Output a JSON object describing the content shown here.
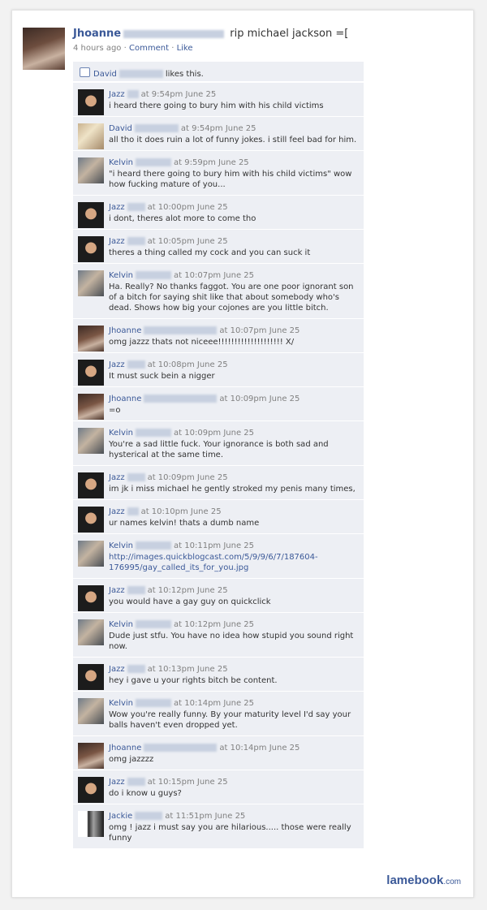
{
  "post": {
    "author": "Jhoanne",
    "status": "rip michael jackson =[",
    "time": "4 hours ago",
    "comment_label": "Comment",
    "like_label": "Like",
    "separator": "·"
  },
  "likes": {
    "name": "David",
    "text": "likes this."
  },
  "comments": [
    {
      "name": "Jazz",
      "av": "jazz",
      "blur": 14,
      "time": "at 9:54pm June 25",
      "text": "i heard there going to bury him with his child victims"
    },
    {
      "name": "David",
      "av": "david",
      "blur": 54,
      "time": "at 9:54pm June 25",
      "text": "all tho it does ruin a lot of funny jokes. i still feel bad for him."
    },
    {
      "name": "Kelvin",
      "av": "kelvin",
      "blur": 44,
      "time": "at 9:59pm June 25",
      "text": "\"i heard there going to bury him with his child victims\" wow how fucking mature of you..."
    },
    {
      "name": "Jazz",
      "av": "jazz",
      "blur": 22,
      "time": "at 10:00pm June 25",
      "text": "i dont, theres alot more to come tho"
    },
    {
      "name": "Jazz",
      "av": "jazz",
      "blur": 22,
      "time": "at 10:05pm June 25",
      "text": "theres a thing called my cock and you can suck it"
    },
    {
      "name": "Kelvin",
      "av": "kelvin",
      "blur": 44,
      "time": "at 10:07pm June 25",
      "text": "Ha. Really? No thanks faggot. You are one poor ignorant son of a bitch for saying shit like that about somebody who's dead. Shows how big your cojones are you little bitch."
    },
    {
      "name": "Jhoanne",
      "av": "jhoanne",
      "blur": 90,
      "time": "at 10:07pm June 25",
      "text": "omg jazzz thats not niceee!!!!!!!!!!!!!!!!!!!! X/"
    },
    {
      "name": "Jazz",
      "av": "jazz",
      "blur": 22,
      "time": "at 10:08pm June 25",
      "text": "It must suck bein a nigger"
    },
    {
      "name": "Jhoanne",
      "av": "jhoanne",
      "blur": 90,
      "time": "at 10:09pm June 25",
      "text": "=o"
    },
    {
      "name": "Kelvin",
      "av": "kelvin",
      "blur": 44,
      "time": "at 10:09pm June 25",
      "text": "You're a sad little fuck. Your ignorance is both sad and hysterical at the same time."
    },
    {
      "name": "Jazz",
      "av": "jazz",
      "blur": 22,
      "time": "at 10:09pm June 25",
      "text": "im jk i miss michael he gently stroked my penis many times,"
    },
    {
      "name": "Jazz",
      "av": "jazz",
      "blur": 14,
      "time": "at 10:10pm June 25",
      "text": "ur names kelvin! thats a dumb name"
    },
    {
      "name": "Kelvin",
      "av": "kelvin",
      "blur": 44,
      "time": "at 10:11pm June 25",
      "text": "http://images.quickblogcast.com/5/9/9/6/7/187604-176995/gay_called_its_for_you.jpg",
      "link": true
    },
    {
      "name": "Jazz",
      "av": "jazz",
      "blur": 22,
      "time": "at 10:12pm June 25",
      "text": "you would have a gay guy on quickclick"
    },
    {
      "name": "Kelvin",
      "av": "kelvin",
      "blur": 44,
      "time": "at 10:12pm June 25",
      "text": "Dude just stfu. You have no idea how stupid you sound right now."
    },
    {
      "name": "Jazz",
      "av": "jazz",
      "blur": 22,
      "time": "at 10:13pm June 25",
      "text": "hey i gave u your rights bitch be content."
    },
    {
      "name": "Kelvin",
      "av": "kelvin",
      "blur": 44,
      "time": "at 10:14pm June 25",
      "text": "Wow you're really funny. By your maturity level I'd say your balls haven't even dropped yet."
    },
    {
      "name": "Jhoanne",
      "av": "jhoanne",
      "blur": 90,
      "time": "at 10:14pm June 25",
      "text": "omg jazzzz"
    },
    {
      "name": "Jazz",
      "av": "jazz",
      "blur": 22,
      "time": "at 10:15pm June 25",
      "text": "do i know u guys?"
    },
    {
      "name": "Jackie",
      "av": "jackie",
      "blur": 34,
      "time": "at 11:51pm June 25",
      "text": "omg ! jazz i must say you are hilarious..... those were really funny"
    }
  ],
  "logo": {
    "brand": "lamebook",
    "domain": ".com"
  },
  "colors": {
    "link": "#3b5998",
    "comment_bg": "#edeff4",
    "meta": "#808080",
    "page_bg": "#f2f2f2"
  }
}
